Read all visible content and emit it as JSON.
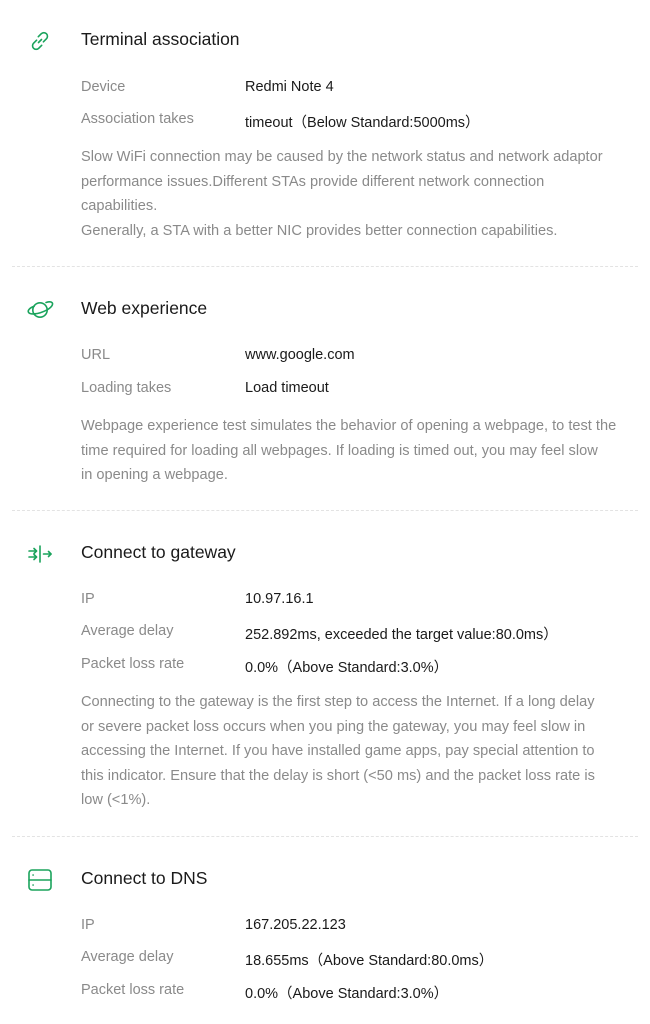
{
  "accent_color": "#1aa35c",
  "sections": [
    {
      "icon": "link-icon",
      "title": "Terminal association",
      "rows": [
        {
          "label": "Device",
          "value": "Redmi Note 4"
        },
        {
          "label": "Association takes",
          "value": "timeout（Below Standard:5000ms）"
        }
      ],
      "description": "Slow WiFi connection may be caused by the network status and network adaptor\nperformance issues.Different STAs provide different network connection\ncapabilities.\n Generally, a STA with a better NIC provides better connection capabilities."
    },
    {
      "icon": "planet-icon",
      "title": "Web experience",
      "rows": [
        {
          "label": "URL",
          "value": "www.google.com"
        },
        {
          "label": "Loading takes",
          "value": "Load timeout"
        }
      ],
      "description": "Webpage experience test simulates the behavior of opening a webpage, to test the\ntime required for loading all webpages. If loading is timed out, you may feel slow\nin opening a webpage."
    },
    {
      "icon": "gateway-icon",
      "title": "Connect to gateway",
      "rows": [
        {
          "label": "IP",
          "value": "10.97.16.1"
        },
        {
          "label": "Average delay",
          "value": "252.892ms, exceeded the target value:80.0ms）"
        },
        {
          "label": "Packet loss rate",
          "value": "0.0%（Above Standard:3.0%）"
        }
      ],
      "description": "Connecting to the gateway is the first step to access the Internet. If a long delay\nor severe packet loss occurs when you ping the gateway, you may feel slow in\naccessing the Internet. If you have installed game apps, pay special attention to\nthis indicator. Ensure that the delay is short (<50 ms) and the packet loss rate is\nlow (<1%)."
    },
    {
      "icon": "server-icon",
      "title": "Connect to DNS",
      "rows": [
        {
          "label": "IP",
          "value": "167.205.22.123"
        },
        {
          "label": "Average delay",
          "value": "18.655ms（Above Standard:80.0ms）"
        },
        {
          "label": "Packet loss rate",
          "value": "0.0%（Above Standard:3.0%）"
        }
      ],
      "description": ""
    }
  ]
}
